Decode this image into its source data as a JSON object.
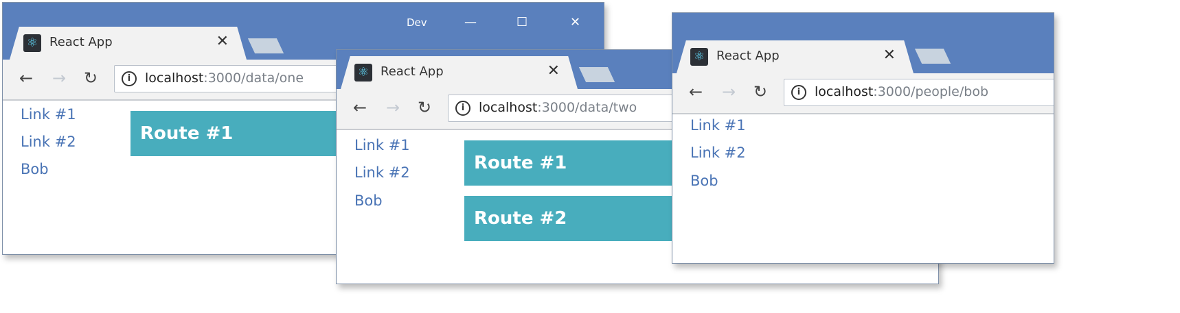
{
  "colors": {
    "frame": "#5a80bd",
    "route_bg": "#48adbd",
    "link": "#4a74b5"
  },
  "windows": [
    {
      "window_title": "Dev",
      "tab_title": "React App",
      "tab_icon": "react-logo-icon",
      "url_host": "localhost",
      "url_path": ":3000/data/one",
      "links": [
        "Link #1",
        "Link #2",
        "Bob"
      ],
      "routes": [
        "Route #1"
      ],
      "controls": {
        "minimize": "—",
        "maximize": "☐",
        "close": "✕"
      }
    },
    {
      "tab_title": "React App",
      "tab_icon": "react-logo-icon",
      "url_host": "localhost",
      "url_path": ":3000/data/two",
      "links": [
        "Link #1",
        "Link #2",
        "Bob"
      ],
      "routes": [
        "Route #1",
        "Route #2"
      ]
    },
    {
      "tab_title": "React App",
      "tab_icon": "react-logo-icon",
      "url_host": "localhost",
      "url_path": ":3000/people/bob",
      "links": [
        "Link #1",
        "Link #2",
        "Bob"
      ],
      "routes": []
    }
  ],
  "icons": {
    "back": "←",
    "forward": "→",
    "reload": "↻",
    "info": "i",
    "tab_close": "✕",
    "favicon": "⚛"
  }
}
